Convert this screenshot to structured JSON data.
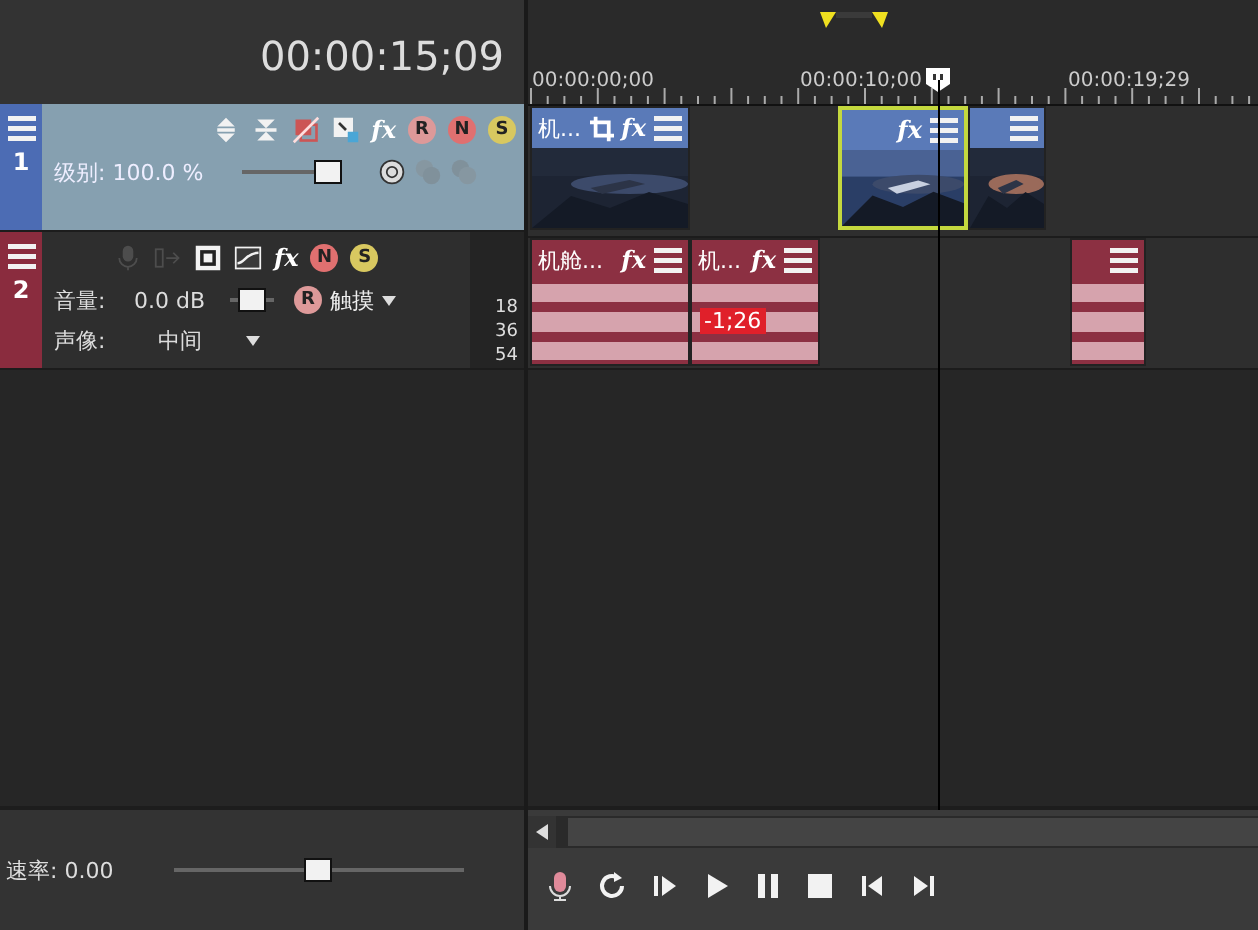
{
  "timecode": "00:00:15;09",
  "ruler": {
    "labels": [
      "00:00:00;00",
      "00:00:10;00",
      "00:00:19;29"
    ]
  },
  "video_track": {
    "number": "1",
    "level_label": "级别: 100.0 %",
    "level": 1.0,
    "tools": [
      {
        "kind": "expand",
        "disabled": false
      },
      {
        "kind": "collapse",
        "disabled": false
      },
      {
        "kind": "bypass",
        "disabled": false
      },
      {
        "kind": "crop",
        "disabled": false
      },
      {
        "kind": "fx",
        "text": "fx",
        "disabled": false
      },
      {
        "kind": "gear",
        "text": "R",
        "disabled": false
      },
      {
        "kind": "mute",
        "text": "N",
        "disabled": false
      },
      {
        "kind": "solo",
        "text": "S",
        "disabled": false
      }
    ],
    "modes": [
      {
        "kind": "composite",
        "disabled": false
      },
      {
        "kind": "parent",
        "disabled": true
      },
      {
        "kind": "child",
        "disabled": true
      }
    ]
  },
  "audio_track": {
    "number": "2",
    "volume_label": "音量:",
    "volume_value": "0.0 dB",
    "level": 0.5,
    "pan_label": "声像:",
    "pan_value": "中间",
    "mode_text": "R",
    "mode_label": "触摸",
    "meter_ticks": [
      "18",
      "36",
      "54"
    ],
    "tools": [
      {
        "kind": "mic",
        "disabled": true
      },
      {
        "kind": "input",
        "disabled": true
      },
      {
        "kind": "square",
        "disabled": false
      },
      {
        "kind": "envelope",
        "disabled": false
      },
      {
        "kind": "fx",
        "text": "fx",
        "disabled": false
      },
      {
        "kind": "mute",
        "text": "N",
        "disabled": false
      },
      {
        "kind": "solo",
        "text": "S",
        "disabled": false
      }
    ]
  },
  "video_clips": [
    {
      "title": "机...",
      "crop": true,
      "fx": "fx",
      "selected": false
    },
    {
      "fx": "fx",
      "selected": true
    },
    {
      "selected": false
    }
  ],
  "audio_clips": [
    {
      "title": "机舱...",
      "fx": "fx",
      "selected": false
    },
    {
      "title": "机...",
      "fx": "fx",
      "badge": "-1;26",
      "selected": false
    },
    {
      "selected": false
    }
  ],
  "rate": {
    "label": "速率: 0.00",
    "level": 0.5
  },
  "transport": [
    {
      "kind": "record"
    },
    {
      "kind": "loop"
    },
    {
      "kind": "play-start"
    },
    {
      "kind": "play"
    },
    {
      "kind": "pause"
    },
    {
      "kind": "stop"
    },
    {
      "kind": "prev"
    },
    {
      "kind": "next"
    }
  ]
}
